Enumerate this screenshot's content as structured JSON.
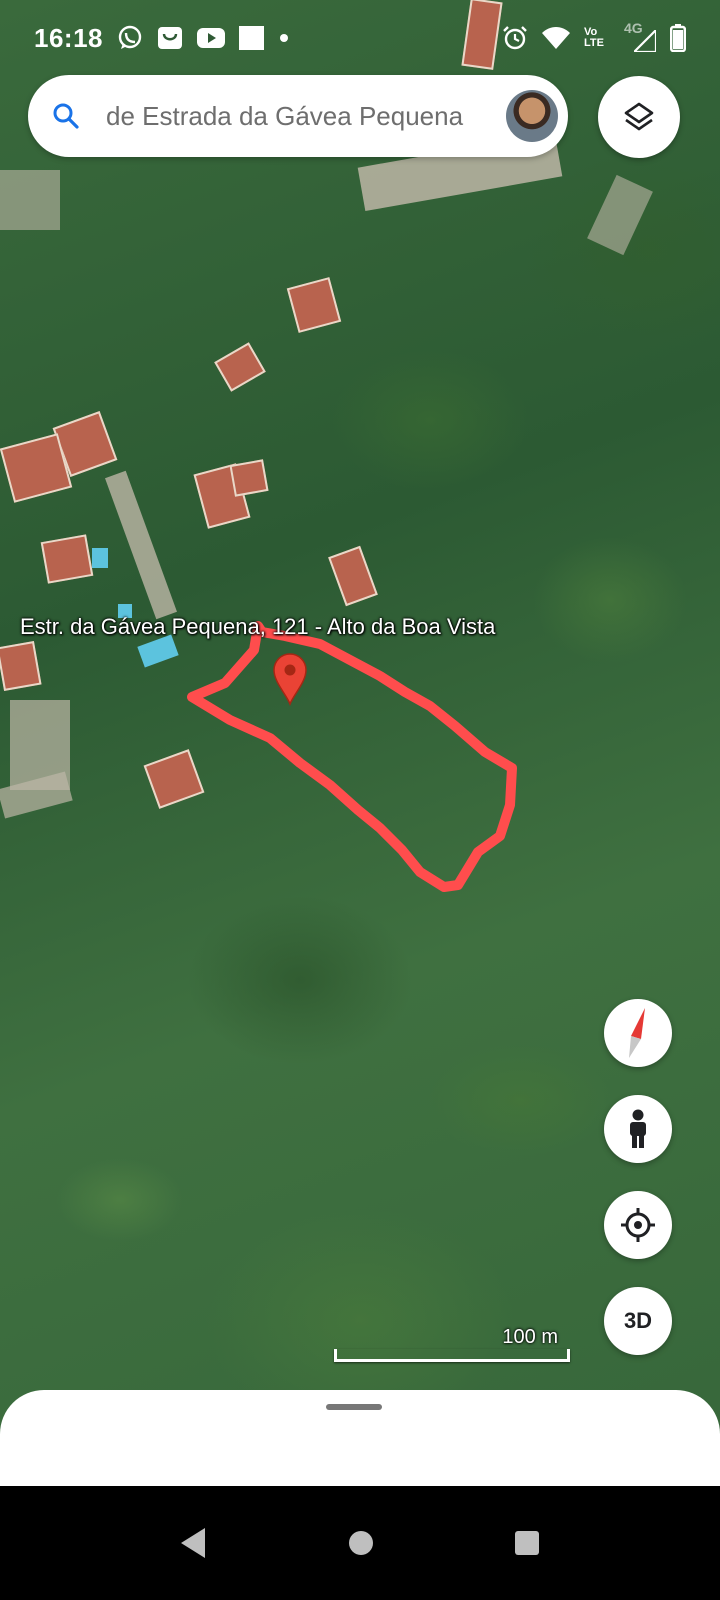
{
  "status_bar": {
    "time": "16:18",
    "notification_icons": [
      "whatsapp-icon",
      "shopping-bag-icon",
      "youtube-icon",
      "square-app-icon",
      "dot-icon"
    ],
    "system_icons": [
      "alarm-icon",
      "wifi-icon",
      "volte-icon",
      "4g-signal-icon",
      "battery-icon"
    ],
    "volte_text": "Vo LTE",
    "network_text": "4G"
  },
  "search": {
    "text": "de Estrada da Gávea Pequena"
  },
  "map": {
    "place_label": "Estr. da Gávea Pequena, 121 - Alto da Boa Vista",
    "scale_label": "100 m",
    "annotation_color": "#ff4d4d",
    "pin_color": "#ea4335"
  },
  "controls": {
    "layers": "layers-icon",
    "compass": "compass-icon",
    "street_view": "pegman-icon",
    "my_location": "my-location-icon",
    "three_d_label": "3D"
  },
  "nav": {
    "back": "back-icon",
    "home": "home-icon",
    "recents": "recents-icon"
  }
}
